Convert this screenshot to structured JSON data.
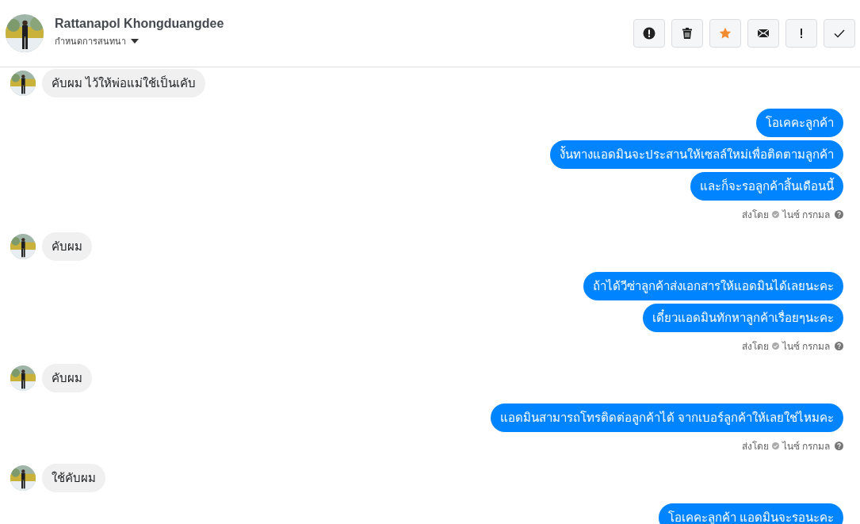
{
  "header": {
    "name": "Rattanapol Khongduangdee",
    "subtitle": "กำหนดการสนทนา",
    "starred": true,
    "buttons": [
      {
        "kind": "alert"
      },
      {
        "kind": "trash"
      },
      {
        "kind": "star"
      },
      {
        "kind": "mail"
      },
      {
        "kind": "exclaim"
      },
      {
        "kind": "check"
      }
    ]
  },
  "groups": [
    {
      "kind": "incoming",
      "messages": [
        "คับผม ไว้ให้พ่อแม่ใช้เป็นเคับ"
      ]
    },
    {
      "kind": "outgoing",
      "messages": [
        "โอเคคะลูกค้า",
        "งั้นทางแอดมินจะประสานให้เซลล์ใหม่เพื่อติดตามลูกค้า",
        "และก็จะรอลูกค้าสิ้นเดือนนี้"
      ],
      "sent_by": "ส่งโดย",
      "sender": "ไนซ์ กรกมล"
    },
    {
      "kind": "incoming",
      "messages": [
        "คับผม"
      ]
    },
    {
      "kind": "outgoing",
      "messages": [
        "ถ้าได้วีซ่าลูกค้าส่งเอกสารให้แอดมินได้เลยนะคะ",
        "เดี๋ยวแอดมินทักหาลูกค้าเรื่อยๆนะคะ"
      ],
      "sent_by": "ส่งโดย",
      "sender": "ไนซ์ กรกมล"
    },
    {
      "kind": "incoming",
      "messages": [
        "คับผม"
      ]
    },
    {
      "kind": "outgoing",
      "messages": [
        "แอดมินสามารถโทรติดต่อลูกค้าได้ จากเบอร์ลูกค้าให้เลยใช่ไหมคะ"
      ],
      "sent_by": "ส่งโดย",
      "sender": "ไนซ์ กรกมล"
    },
    {
      "kind": "incoming",
      "messages": [
        "ใช้คับผม"
      ]
    },
    {
      "kind": "outgoing",
      "messages": [
        "โอเคคะลูกค้า แอดมินจะรอนะคะ"
      ]
    }
  ]
}
